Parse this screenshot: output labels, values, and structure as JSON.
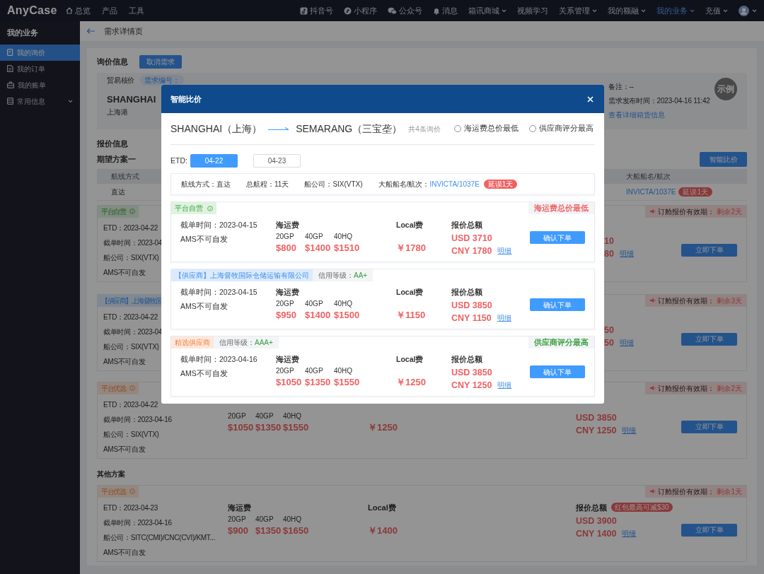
{
  "top_nav": {
    "logo": "AnyCase",
    "left_items": [
      {
        "label": "总览",
        "kind": "icon_link"
      },
      {
        "label": "产品",
        "kind": "link"
      },
      {
        "label": "工具",
        "kind": "link"
      }
    ],
    "right_items": [
      {
        "label": "抖音号",
        "kind": "icon_link",
        "selected": false
      },
      {
        "label": "小程序",
        "kind": "icon_link",
        "selected": false
      },
      {
        "label": "公众号",
        "kind": "icon_link",
        "selected": false
      },
      {
        "label": "消息",
        "kind": "icon_link",
        "selected": false
      },
      {
        "label": "箱讯商城",
        "kind": "dropdown",
        "selected": false
      },
      {
        "label": "视频学习",
        "kind": "link",
        "selected": false
      },
      {
        "label": "关系管理",
        "kind": "dropdown",
        "selected": false
      },
      {
        "label": "我的额融",
        "kind": "dropdown",
        "selected": false
      },
      {
        "label": "我的业务",
        "kind": "dropdown",
        "selected": true
      },
      {
        "label": "充值",
        "kind": "dropdown",
        "selected": false
      }
    ]
  },
  "sidebar": {
    "title": "我的业务",
    "items": [
      {
        "label": "我的询价",
        "kind": "link",
        "selected": true
      },
      {
        "label": "我的订单",
        "kind": "link",
        "selected": false
      },
      {
        "label": "我的账单",
        "kind": "link",
        "selected": false
      },
      {
        "label": "常用信息",
        "kind": "group",
        "selected": false
      }
    ]
  },
  "page_header": {
    "title": "需求详情页"
  },
  "inquiry": {
    "title": "询价信息",
    "cancel_button": "取消需求",
    "trade_label": "贸易核价",
    "number_badge": "需求编号：",
    "port_code": "SHANGHAI",
    "port_name": "上海港",
    "remark": "备注：--",
    "published": "需求发布时间：2023-04-16 11:42",
    "detail_link": "查看详细箱货信息",
    "stamp": "示例"
  },
  "quotes": {
    "title": "报价信息",
    "plan_title": "期望方案一",
    "compare_button": "智能比价",
    "table": {
      "columns": [
        "航线方式",
        "大船船名/航次"
      ],
      "rows": [
        {
          "route": "直达",
          "vessel": "INVICTA/1037E",
          "delay": "延误1天"
        }
      ]
    },
    "cards": [
      {
        "tag": {
          "label": "平台自营",
          "kind": "platform"
        },
        "validity_label": "订舱报价有效期：",
        "validity_value": "剩余2天",
        "etd": "ETD：2023-04-22",
        "cutoff": "截单时间：2023-04",
        "carrier": "船公司：SIX(VTX)",
        "ams": "AMS不可自发",
        "total_fragments": [
          "10",
          "80"
        ],
        "detail_link": "明细",
        "order_button": "立即下单"
      },
      {
        "tag": {
          "label": "【供应商】上海督牧国",
          "kind": "supplier"
        },
        "validity_label": "订舱报价有效期：",
        "validity_value": "剩余3天",
        "etd": "ETD：2023-04-22",
        "cutoff": "截单时间：2023-04",
        "carrier": "船公司：SIX(VTX)",
        "ams": "AMS不可自发",
        "total_fragments": [
          "50",
          "50"
        ],
        "detail_link": "明细",
        "order_button": "立即下单"
      },
      {
        "tag": {
          "label": "平台优选",
          "kind": "preferred"
        },
        "validity_label": "订舱报价有效期：",
        "validity_value": "剩余2天",
        "etd": "ETD：2023-04-22",
        "cutoff": "截单时间：2023-04-16",
        "carrier": "船公司：SIX(VTX)",
        "ams": "AMS不可自发",
        "containers": [
          "20GP",
          "40GP",
          "40HQ"
        ],
        "prices": [
          "$1050",
          "$1350",
          "$1550"
        ],
        "local": "￥1250",
        "usd": "USD 3850",
        "cny": "CNY 1250",
        "detail_link": "明细",
        "order_button": "立即下单"
      }
    ],
    "other_title": "其他方案",
    "other_cards": [
      {
        "tag": {
          "label": "平台优选",
          "kind": "preferred"
        },
        "validity_label": "订舱报价有效期：",
        "validity_value": "剩余1天",
        "etd": "ETD：2023-04-23",
        "cutoff": "截单时间：2023-04-16",
        "carrier": "船公司：SITC(CMI)/CNC(CVI)/KMT...",
        "ams": "AMS不可自发",
        "fee_title": "海运费",
        "containers": [
          "20GP",
          "40GP",
          "40HQ"
        ],
        "prices": [
          "$900",
          "$1350",
          "$1650"
        ],
        "local_title": "Local费",
        "local": "￥1400",
        "total_title": "报价总额",
        "bonus": "红包最高可减$30",
        "usd": "USD 3900",
        "cny": "CNY 1400",
        "detail_link": "明细",
        "order_button": "立即下单"
      }
    ]
  },
  "modal": {
    "title": "智能比价",
    "origin": "SHANGHAI（上海）",
    "destination": "SEMARANG（三宝垄）",
    "count": "共4条询价",
    "sort_options": [
      {
        "label": "海运费总价最低",
        "selected": false
      },
      {
        "label": "供应商评分最高",
        "selected": false
      }
    ],
    "etd_label": "ETD:",
    "dates": [
      {
        "label": "04-22",
        "selected": true
      },
      {
        "label": "04-23",
        "selected": false
      }
    ],
    "route_info": [
      "航线方式：直达",
      "总航程：11天",
      "船公司：SIX(VTX)"
    ],
    "vessel": {
      "label": "大船船名/航次：",
      "value": "INVICTA/1037E",
      "delay": "延误1天"
    },
    "offers": [
      {
        "tag": {
          "label": "平台自营",
          "kind": "platform"
        },
        "ribbon": {
          "label": "海运费总价最低",
          "color": "#f06162"
        },
        "cutoff": "截单时间：2023-04-15",
        "ams": "AMS不可自发",
        "fee_title": "海运费",
        "containers": [
          "20GP",
          "40GP",
          "40HQ"
        ],
        "prices": [
          "$800",
          "$1400",
          "$1510"
        ],
        "local_title": "Local费",
        "local": "￥1780",
        "total_title": "报价总额",
        "usd": "USD 3710",
        "cny": "CNY 1780",
        "detail_link": "明细",
        "confirm_button": "确认下单"
      },
      {
        "tag": {
          "label": "【供应商】上海督牧国际仓储运输有限公司",
          "kind": "supplier"
        },
        "credit_label": "信用等级：",
        "credit": "AA+",
        "cutoff": "截单时间：2023-04-15",
        "ams": "AMS不可自发",
        "fee_title": "海运费",
        "containers": [
          "20GP",
          "40GP",
          "40HQ"
        ],
        "prices": [
          "$950",
          "$1400",
          "$1500"
        ],
        "local_title": "Local费",
        "local": "￥1150",
        "total_title": "报价总额",
        "usd": "USD 3850",
        "cny": "CNY 1150",
        "detail_link": "明细",
        "confirm_button": "确认下单"
      },
      {
        "tag": {
          "label": "精选供应商",
          "kind": "featured"
        },
        "credit_label": "信用等级：",
        "credit": "AAA+",
        "ribbon": {
          "label": "供应商评分最高",
          "color": "#3aa13e"
        },
        "cutoff": "截单时间：2023-04-16",
        "ams": "AMS不可自发",
        "fee_title": "海运费",
        "containers": [
          "20GP",
          "40GP",
          "40HQ"
        ],
        "prices": [
          "$1050",
          "$1350",
          "$1550"
        ],
        "local_title": "Local费",
        "local": "￥1250",
        "total_title": "报价总额",
        "usd": "USD 3850",
        "cny": "CNY 1250",
        "detail_link": "明细",
        "confirm_button": "确认下单"
      }
    ]
  }
}
